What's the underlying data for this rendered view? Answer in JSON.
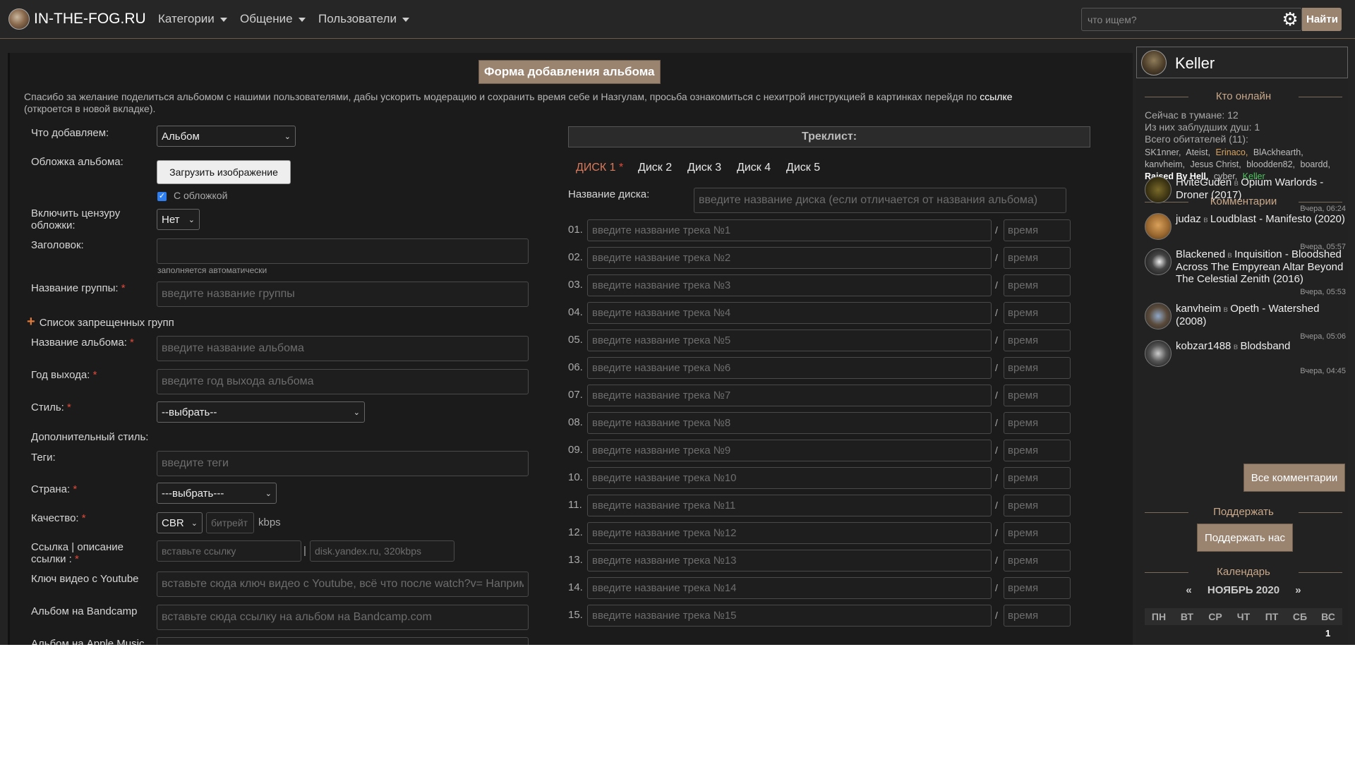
{
  "nav": {
    "logo_text": "IN-THE-FOG.RU",
    "items": [
      "Категории",
      "Общение",
      "Пользователи"
    ],
    "search_placeholder": "что ищем?",
    "find_label": "Найти"
  },
  "form": {
    "title": "Форма добавления альбома",
    "intro": "Спасибо за желание поделиться альбомом с нашими пользователями, дабы ускорить модерацию и сохранить время себе и Назгулам, просьба ознакомиться с нехитрой инструкцией в картинках перейдя по",
    "intro_link": "ссылке",
    "intro_tail": "(откроется в новой вкладке).",
    "what_label": "Что добавляем:",
    "what_value": "Альбом",
    "cover_label": "Обложка альбома:",
    "cover_button": "Загрузить изображение",
    "cover_check": "С обложкой",
    "censor_label": "Включить цензуру обложки:",
    "censor_value": "Нет",
    "heading_label": "Заголовок:",
    "heading_hint": "заполняется автоматически",
    "band_label": "Название группы:",
    "band_placeholder": "введите название группы",
    "banned_label": "Список запрещенных групп",
    "album_label": "Название альбома:",
    "album_placeholder": "введите название альбома",
    "year_label": "Год выхода:",
    "year_placeholder": "введите год выхода альбома",
    "style_label": "Стиль:",
    "style_value": "--выбрать--",
    "addstyle_label": "Дополнительный стиль:",
    "tags_label": "Теги:",
    "tags_placeholder": "введите теги",
    "country_label": "Страна:",
    "country_value": "---выбрать---",
    "quality_label": "Качество:",
    "quality_value": "CBR",
    "bitrate_placeholder": "битрейт",
    "kbps": "kbps",
    "link_label": "Ссылка | описание ссылки :",
    "link_placeholder": "вставьте ссылку",
    "link_sep": "|",
    "link_desc_placeholder": "disk.yandex.ru, 320kbps",
    "youtube_label": "Ключ видео с Youtube",
    "youtube_placeholder": "вставьте сюда ключ видео с Youtube, всё что после watch?v= Наприм",
    "bandcamp_label": "Альбом на Bandcamp",
    "bandcamp_placeholder": "вставьте сюда ссылку на альбом на Bandcamp.com",
    "apple_label": "Альбом на Apple Music"
  },
  "tracklist": {
    "title": "Треклист:",
    "discs": [
      "ДИСК 1",
      "Диск 2",
      "Диск 3",
      "Диск 4",
      "Диск 5"
    ],
    "disc_name_label": "Название диска:",
    "disc_name_placeholder": "введите название диска (если отличается от названия альбома)",
    "time_placeholder": "время",
    "tracks": [
      {
        "no": "01.",
        "ph": "введите название трека №1"
      },
      {
        "no": "02.",
        "ph": "введите название трека №2"
      },
      {
        "no": "03.",
        "ph": "введите название трека №3"
      },
      {
        "no": "04.",
        "ph": "введите название трека №4"
      },
      {
        "no": "05.",
        "ph": "введите название трека №5"
      },
      {
        "no": "06.",
        "ph": "введите название трека №6"
      },
      {
        "no": "07.",
        "ph": "введите название трека №7"
      },
      {
        "no": "08.",
        "ph": "введите название трека №8"
      },
      {
        "no": "09.",
        "ph": "введите название трека №9"
      },
      {
        "no": "10.",
        "ph": "введите название трека №10"
      },
      {
        "no": "11.",
        "ph": "введите название трека №11"
      },
      {
        "no": "12.",
        "ph": "введите название трека №12"
      },
      {
        "no": "13.",
        "ph": "введите название трека №13"
      },
      {
        "no": "14.",
        "ph": "введите название трека №14"
      },
      {
        "no": "15.",
        "ph": "введите название трека №15"
      }
    ]
  },
  "sidebar": {
    "user": "Keller",
    "online_title": "Кто онлайн",
    "online_now": "Сейчас в тумане: 12",
    "lost_souls": "Из них заблудших душ: 1",
    "total": "Всего обитателей (11):",
    "users": [
      {
        "name": "SK1nner",
        "color": "#bdbdbd"
      },
      {
        "name": "Ateist",
        "color": "#bdbdbd"
      },
      {
        "name": "Erinaco",
        "color": "#d7a35f"
      },
      {
        "name": "BlAckhearth",
        "color": "#bdbdbd"
      },
      {
        "name": "kanvheim",
        "color": "#bdbdbd"
      },
      {
        "name": "Jesus Christ",
        "color": "#bdbdbd"
      },
      {
        "name": "blooddеn82",
        "color": "#bdbdbd"
      },
      {
        "name": "boardd",
        "color": "#bdbdbd"
      },
      {
        "name": "Raised By Hell",
        "color": "#ffffff"
      },
      {
        "name": "cyber",
        "color": "#bdbdbd"
      },
      {
        "name": "Keller",
        "color": "#4cc45c"
      }
    ],
    "comments_title": "Комментарии",
    "in_word": "в",
    "comments": [
      {
        "user": "HviteGuden",
        "target": "Opium Warlords - Droner (2017)",
        "date": "Вчера, 06:24"
      },
      {
        "user": "judaz",
        "target": "Loudblast - Manifesto (2020)",
        "date": "Вчера, 05:57"
      },
      {
        "user": "Blackened",
        "target": "Inquisition - Bloodshed Across The Empyrean Altar Beyond The Celestial Zenith (2016)",
        "date": "Вчера, 05:53"
      },
      {
        "user": "kanvheim",
        "target": "Opeth - Watershed (2008)",
        "date": "Вчера, 05:06"
      },
      {
        "user": "kobzar1488",
        "target": "Blodsband",
        "date": "Вчера, 04:45"
      }
    ],
    "all_comments": "Все комментарии",
    "support_title": "Поддержать",
    "support_button": "Поддержать нас",
    "calendar_title": "Календарь",
    "calendar_prev": "«",
    "calendar_month": "НОЯБРЬ 2020",
    "calendar_next": "»",
    "weekdays": [
      "ПН",
      "ВТ",
      "СР",
      "ЧТ",
      "ПТ",
      "СБ",
      "ВС"
    ],
    "first_day": "1"
  }
}
